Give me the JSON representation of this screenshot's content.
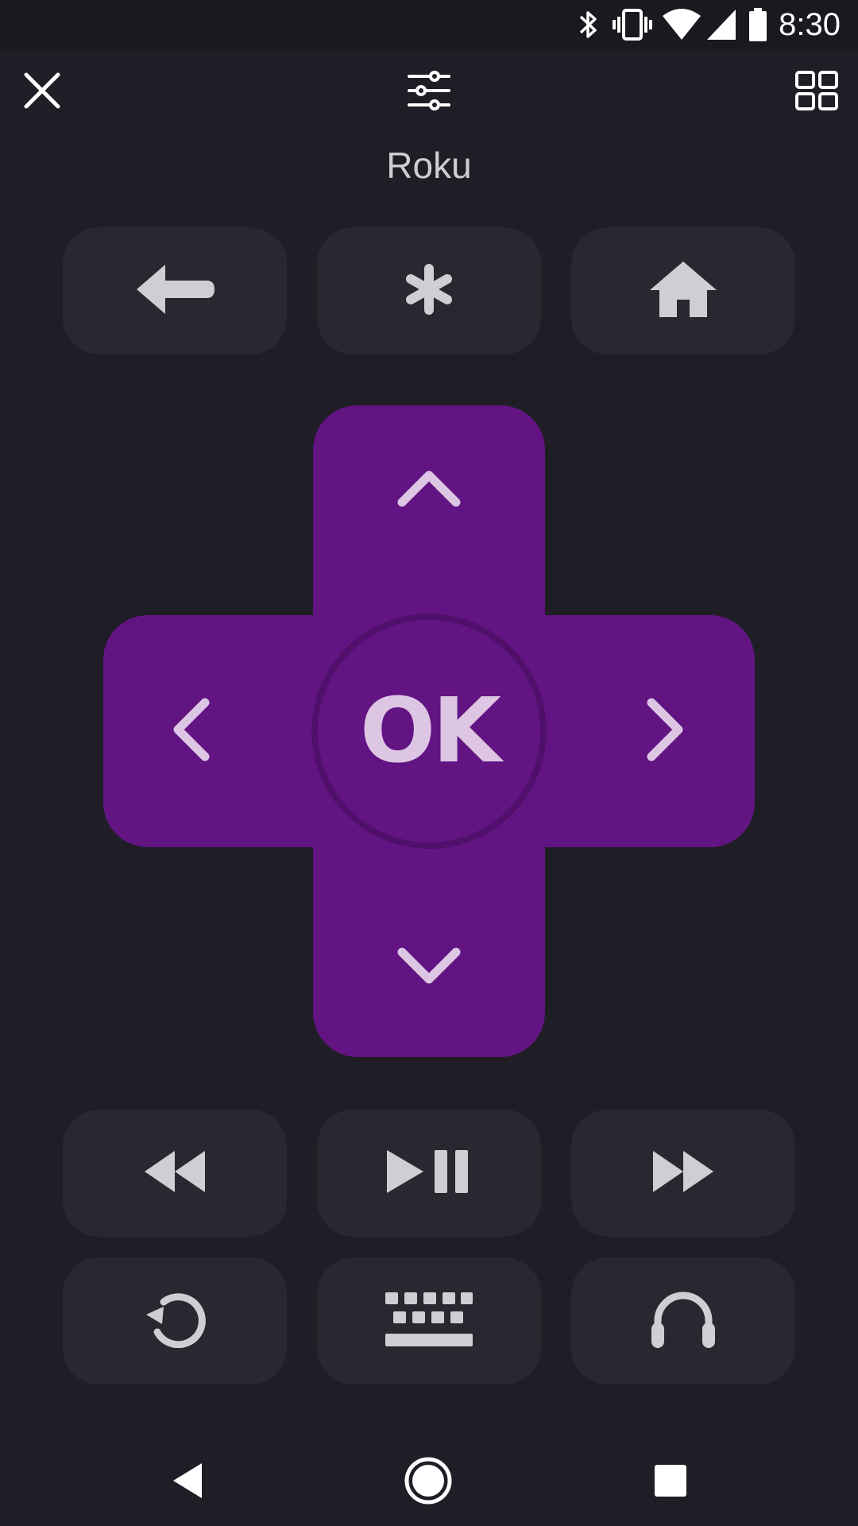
{
  "status_bar": {
    "time": "8:30",
    "icons": [
      "bluetooth-icon",
      "vibrate-icon",
      "wifi-icon",
      "signal-icon",
      "battery-icon"
    ]
  },
  "header": {
    "device_name": "Roku",
    "icons": [
      "close-icon",
      "settings-sliders-icon",
      "grid-view-icon"
    ]
  },
  "dpad": {
    "ok_label": "OK",
    "color": "#631483",
    "ring_color": "#4f0f6b",
    "glyph_color": "#dcc6e4"
  },
  "buttons": {
    "top_row": [
      "back-arrow-icon",
      "asterisk-icon",
      "home-icon"
    ],
    "media_row": [
      "rewind-icon",
      "play-pause-icon",
      "fast-forward-icon"
    ],
    "bottom_row": [
      "replay-icon",
      "keyboard-icon",
      "headphones-icon"
    ]
  },
  "nav_bar": {
    "icons": [
      "nav-back-icon",
      "nav-home-icon",
      "nav-recents-icon"
    ]
  },
  "colors": {
    "background": "#1f1d25",
    "button": "#2a2731",
    "icon": "#d0ced4"
  }
}
